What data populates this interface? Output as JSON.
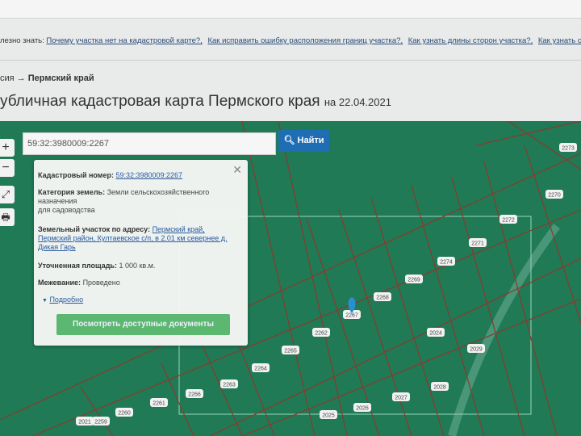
{
  "useful": {
    "label": "лезно знать:",
    "links": [
      "Почему участка нет на кадастровой карте?,",
      "Как исправить ошибку расположения границ участка?,",
      "Как узнать длины сторон участка?,",
      "Как узнать с"
    ]
  },
  "breadcrumb": {
    "prefix": "сия →",
    "current": "Пермский край"
  },
  "page": {
    "title": "убличная кадастровая карта Пермского края",
    "date": "на 22.04.2021"
  },
  "map_controls": {
    "zoom_in": "+",
    "zoom_out": "−",
    "fullscreen": "⤢",
    "print": "🖶"
  },
  "search": {
    "value": "59:32:3980009:2267",
    "button": "Найти"
  },
  "popup": {
    "cad_label": "Кадастровый номер:",
    "cad_value": "59:32:3980009:2267",
    "cat_label": "Категория земель:",
    "cat_value": "Земли сельскохозяйственного назначения",
    "use": "для садоводства",
    "addr_label": "Земельный участок по адресу:",
    "addr_value": "Пермский край, Пермский район, Култаевское с/п, в 2.01 км севернее д. Дикая Гарь",
    "area_label": "Уточненная площадь:",
    "area_value": "1 000 кв.м.",
    "survey_label": "Межевание:",
    "survey_value": "Проведено",
    "more": "Подробно",
    "docs_button": "Посмотреть доступные документы"
  },
  "plots": [
    "2273",
    "2270",
    "2272",
    "2271",
    "2274",
    "2269",
    "2268",
    "2267",
    "2262",
    "2265",
    "2264",
    "2263",
    "2266",
    "2261",
    "2260",
    "2259",
    "2021",
    "2024",
    "2029",
    "2028",
    "2027",
    "2026",
    "2025"
  ],
  "colors": {
    "map": "#1f7a55",
    "boundary": "#8b3a2e",
    "button": "#1f6db3",
    "docs": "#5cb870"
  }
}
